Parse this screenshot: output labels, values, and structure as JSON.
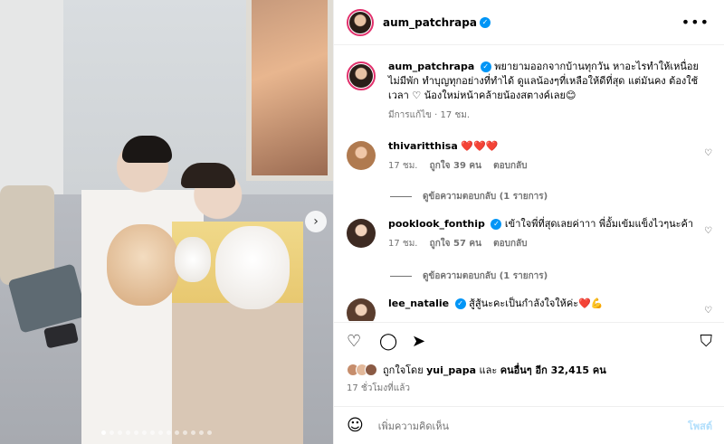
{
  "post": {
    "username": "aum_patchrapa",
    "more_icon": "more-icon"
  },
  "caption": {
    "username": "aum_patchrapa",
    "text": "พยายามออกจากบ้านทุกวัน หาอะไรทำให้เหนื่อย ไม่มีพัก ทำบุญทุกอย่างที่ทำได้ ดูแลน้องๆที่เหลือให้ดีที่สุด แต่มันคง ต้องใช้เวลา ♡ น้องใหม่หน้าคล้ายน้องสตางค์เลย😊",
    "meta": "มีการแก้ไข · 17 ชม."
  },
  "comments": [
    {
      "username": "thivaritthisa",
      "text": "❤️❤️❤️",
      "time": "17 ชม.",
      "likes": "ถูกใจ 39 คน",
      "reply": "ตอบกลับ",
      "view_replies": "ดูข้อความตอบกลับ (1 รายการ)"
    },
    {
      "username": "pooklook_fonthip",
      "text": "เข้าใจพี่ที่สุดเลยค่าาา พี่อั้มเข้มแข็งไวๆนะค้า",
      "time": "17 ชม.",
      "likes": "ถูกใจ 57 คน",
      "reply": "ตอบกลับ",
      "view_replies": "ดูข้อความตอบกลับ (1 รายการ)"
    },
    {
      "username": "lee_natalie",
      "text": "สู้สู้นะคะเป็นกำลังใจให้ค่ะ❤️💪"
    }
  ],
  "likes": {
    "prefix": "ถูกใจโดย",
    "user": "yui_papa",
    "middle": "และ",
    "others": "คนอื่นๆ อีก 32,415 คน"
  },
  "time_ago": "17 ชั่วโมงที่แล้ว",
  "composer": {
    "placeholder": "เพิ่มความคิดเห็น",
    "post_label": "โพสต์"
  },
  "colors": {
    "accent": "#0095f6",
    "heart": "#e0245e",
    "muted": "#737373"
  }
}
